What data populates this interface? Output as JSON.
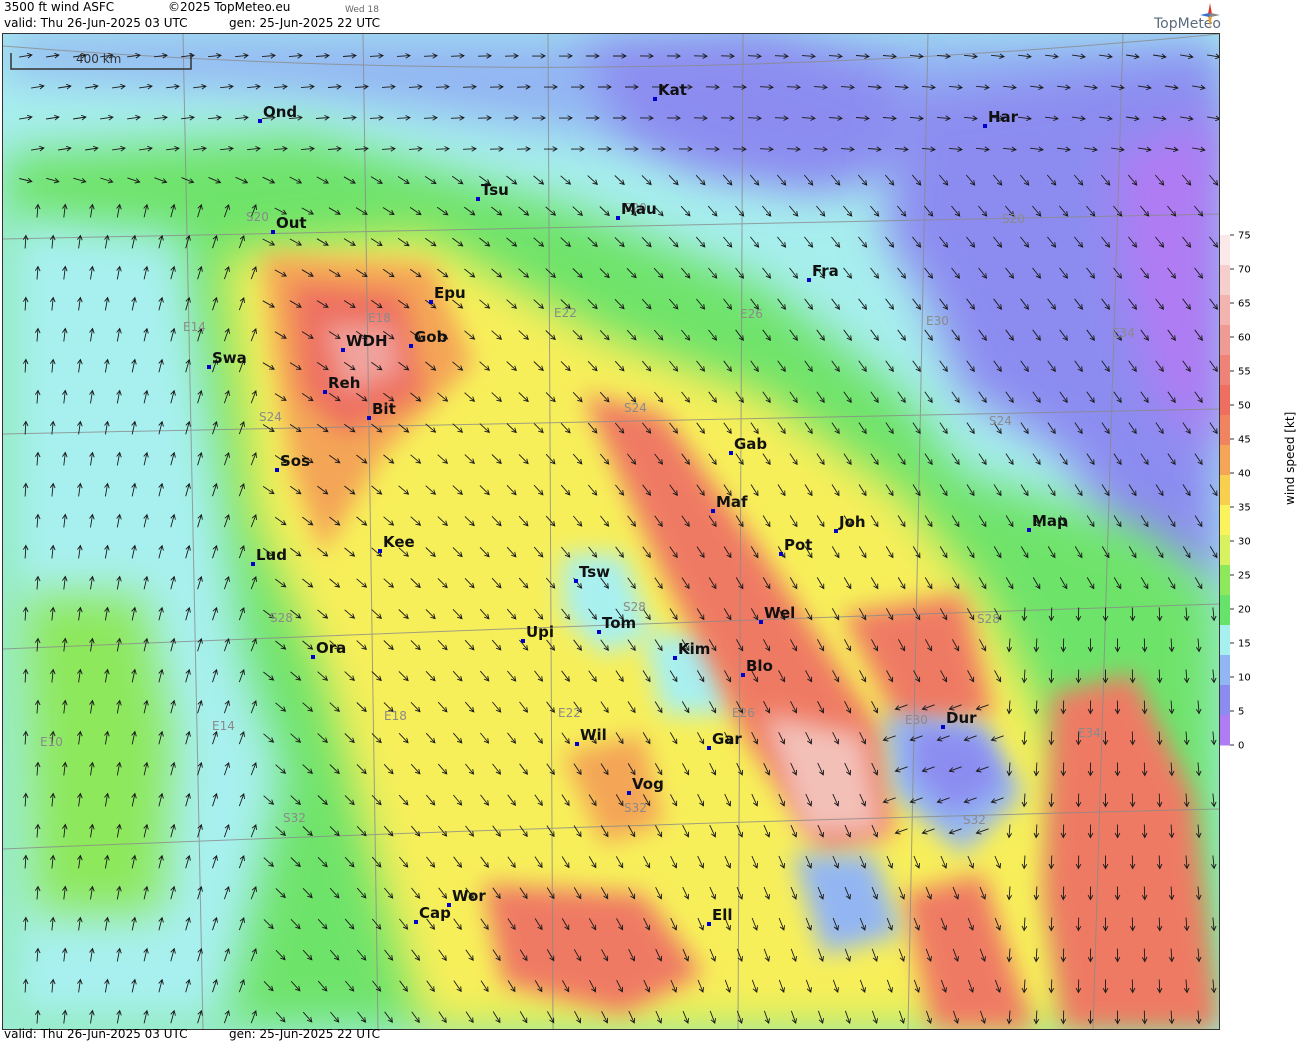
{
  "header": {
    "product": "3500 ft wind ASFC",
    "copyright": "©2025 TopMeteo.eu",
    "day_hint": "Wed 18",
    "valid_line": "valid:  Thu   26-Jun-2025  03 UTC",
    "gen_line": "gen:  25-Jun-2025 22 UTC"
  },
  "footer": {
    "valid_line": "valid:  Thu   26-Jun-2025  03 UTC",
    "gen_line": "gen:  25-Jun-2025 22 UTC"
  },
  "logo": {
    "name": "TopMeteo",
    "icon": "compass-star-icon"
  },
  "scale_bar": {
    "label": "400 km"
  },
  "legend": {
    "title": "wind speed  [kt]",
    "ticks": [
      "75",
      "70",
      "65",
      "60",
      "55",
      "50",
      "45",
      "40",
      "35",
      "30",
      "25",
      "20",
      "15",
      "10",
      "5",
      "0"
    ],
    "colors": [
      "#fbe9e9",
      "#f6cfcd",
      "#f3b3af",
      "#f09a94",
      "#ef8378",
      "#ee6f60",
      "#f0845f",
      "#f4a557",
      "#f8d04d",
      "#fbf35c",
      "#d7f25e",
      "#8de85c",
      "#67e26b",
      "#a8f0f0",
      "#92b6f3",
      "#8c8cf0",
      "#b07cf3"
    ]
  },
  "cities": [
    {
      "name": "Kat"
    },
    {
      "name": "Ond"
    },
    {
      "name": "Har"
    },
    {
      "name": "Tsu"
    },
    {
      "name": "Mau"
    },
    {
      "name": "Out"
    },
    {
      "name": "Fra"
    },
    {
      "name": "Epu"
    },
    {
      "name": "WDH"
    },
    {
      "name": "Gob"
    },
    {
      "name": "Swa"
    },
    {
      "name": "Reh"
    },
    {
      "name": "Bit"
    },
    {
      "name": "Gab"
    },
    {
      "name": "Sos"
    },
    {
      "name": "Maf"
    },
    {
      "name": "Joh"
    },
    {
      "name": "Map"
    },
    {
      "name": "Pot"
    },
    {
      "name": "Kee"
    },
    {
      "name": "Lud"
    },
    {
      "name": "Tsw"
    },
    {
      "name": "Wel"
    },
    {
      "name": "Tom"
    },
    {
      "name": "Upi"
    },
    {
      "name": "Kim"
    },
    {
      "name": "Ora"
    },
    {
      "name": "Blo"
    },
    {
      "name": "Dur"
    },
    {
      "name": "Wil"
    },
    {
      "name": "Gar"
    },
    {
      "name": "Vog"
    },
    {
      "name": "Wor"
    },
    {
      "name": "Cap"
    },
    {
      "name": "Ell"
    }
  ],
  "sector_labels": [
    {
      "text": "S20"
    },
    {
      "text": "S20"
    },
    {
      "text": "S20"
    },
    {
      "text": "E14"
    },
    {
      "text": "E18"
    },
    {
      "text": "E22"
    },
    {
      "text": "E26"
    },
    {
      "text": "E30"
    },
    {
      "text": "E34"
    },
    {
      "text": "S24"
    },
    {
      "text": "S24"
    },
    {
      "text": "S24"
    },
    {
      "text": "S28"
    },
    {
      "text": "S28"
    },
    {
      "text": "S28"
    },
    {
      "text": "E10"
    },
    {
      "text": "E14"
    },
    {
      "text": "E18"
    },
    {
      "text": "E22"
    },
    {
      "text": "E26"
    },
    {
      "text": "E30"
    },
    {
      "text": "E34"
    },
    {
      "text": "S32"
    },
    {
      "text": "S32"
    },
    {
      "text": "S32"
    }
  ]
}
